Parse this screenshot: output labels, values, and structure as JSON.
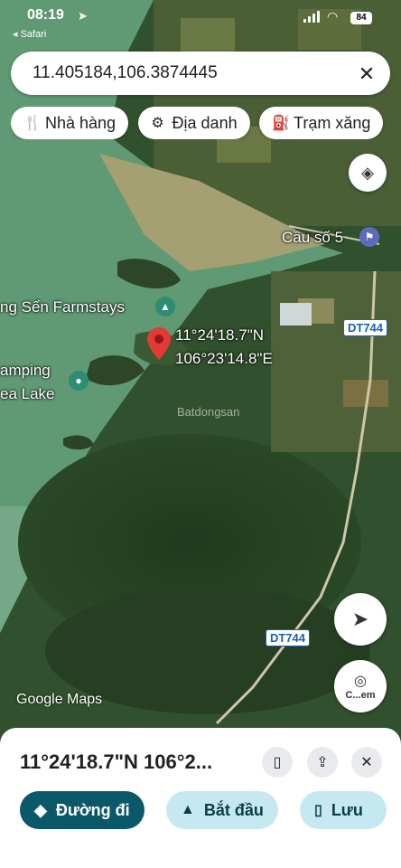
{
  "status_bar": {
    "time": "08:19",
    "back_label": "◂ Safari",
    "battery": "84"
  },
  "search": {
    "value": "11.405184,106.3874445",
    "close_icon": "close-icon"
  },
  "chips": [
    {
      "label": "Nhà hàng",
      "icon": "restaurant-icon"
    },
    {
      "label": "Địa danh",
      "icon": "landmark-icon"
    },
    {
      "label": "Trạm xăng",
      "icon": "gas-station-icon"
    }
  ],
  "map": {
    "labels": {
      "bridge": "Cầu số 5",
      "farmstay": "ng Sến Farmstays",
      "camping_1": "amping",
      "camping_2": "ea Lake",
      "pin_lat": "11°24'18.7\"N",
      "pin_lng": "106°23'14.8\"E",
      "road_1": "DT744",
      "road_2": "DT744",
      "watermark": "Batdongsan",
      "google": "Google Maps",
      "camera_label": "C...em"
    },
    "colors": {
      "water": "#5f9a74",
      "land": "#2f4a2c",
      "pin": "#e53935",
      "poi": "#2e8b74"
    }
  },
  "sheet": {
    "title": "11°24'18.7\"N 106°2...",
    "actions": {
      "directions": "Đường đi",
      "start": "Bắt đầu",
      "save": "Lưu"
    },
    "colors": {
      "primary": "#0b5968",
      "secondary": "#c5e8f1"
    }
  }
}
